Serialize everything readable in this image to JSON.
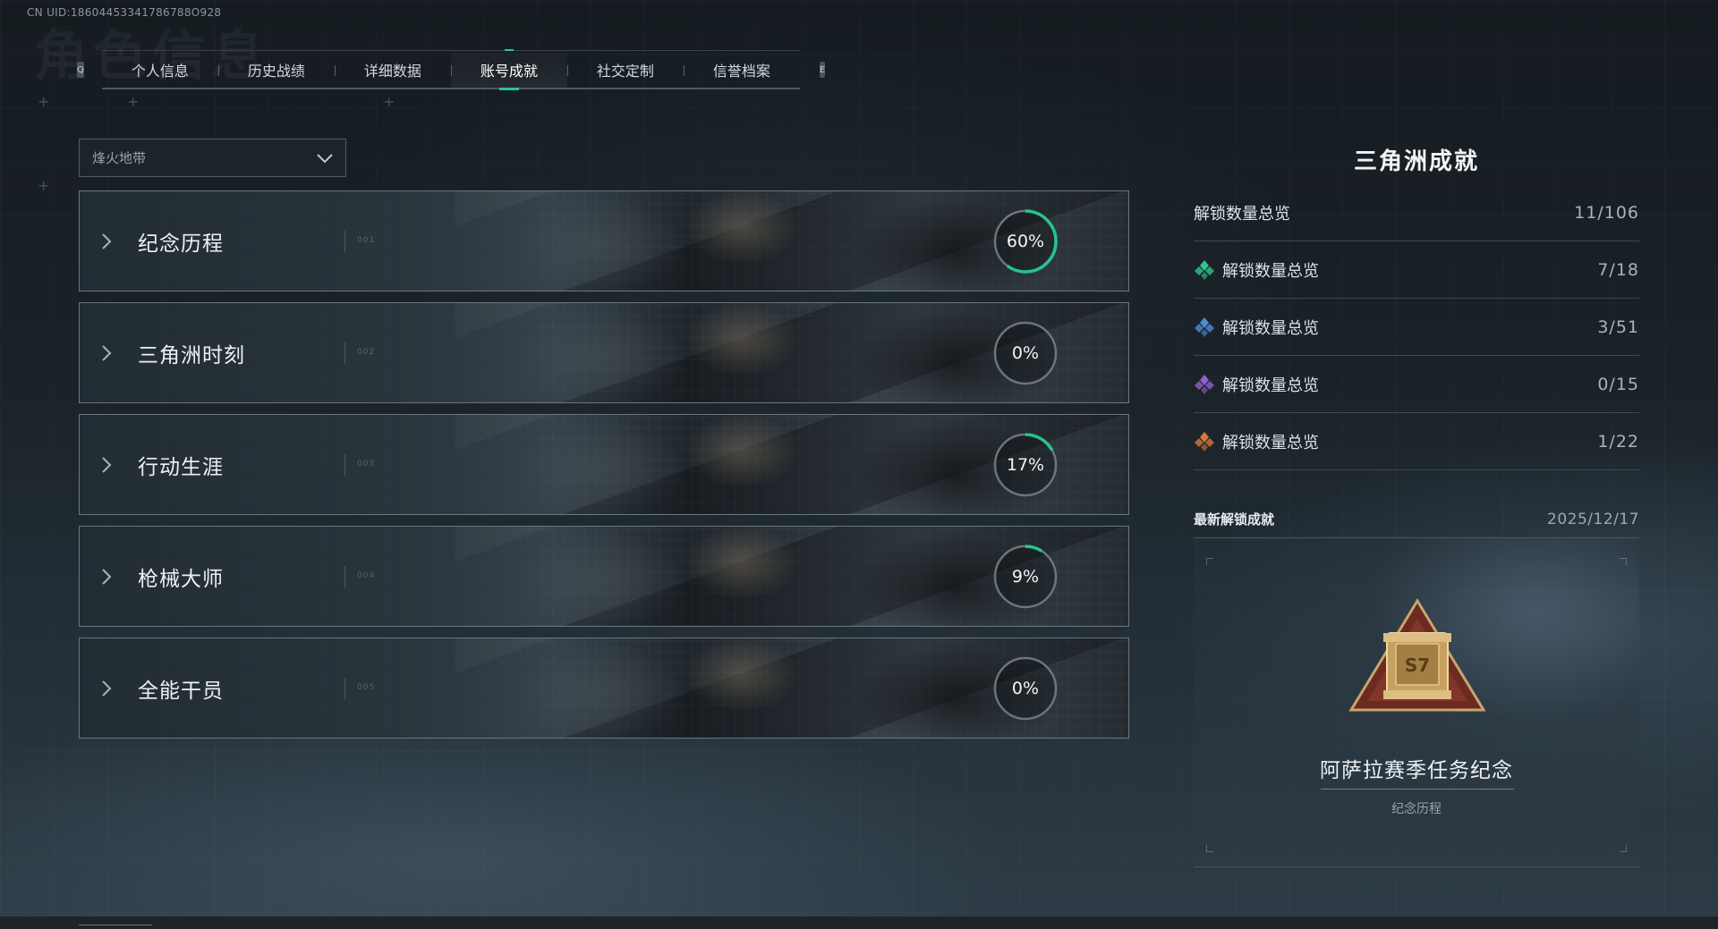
{
  "uid_text": "CN UID:18604453341786788O928",
  "ghost_title": "角色信息",
  "tabs": {
    "prev_key": "Q",
    "next_key": "E",
    "items": [
      {
        "label": "个人信息"
      },
      {
        "label": "历史战绩"
      },
      {
        "label": "详细数据"
      },
      {
        "label": "账号成就",
        "active": true
      },
      {
        "label": "社交定制"
      },
      {
        "label": "信誉档案"
      }
    ]
  },
  "mode_select": {
    "value": "烽火地带",
    "icon": "chevron-down-icon"
  },
  "categories": [
    {
      "name": "纪念历程",
      "index": "001",
      "progress_percent": 60,
      "progress_label": "60%"
    },
    {
      "name": "三角洲时刻",
      "index": "002",
      "progress_percent": 0,
      "progress_label": "0%"
    },
    {
      "name": "行动生涯",
      "index": "003",
      "progress_percent": 17,
      "progress_label": "17%"
    },
    {
      "name": "枪械大师",
      "index": "004",
      "progress_percent": 9,
      "progress_label": "9%"
    },
    {
      "name": "全能干员",
      "index": "005",
      "progress_percent": 0,
      "progress_label": "0%"
    }
  ],
  "panel": {
    "title": "三角洲成就",
    "total": {
      "label": "解锁数量总览",
      "value": "11/106"
    },
    "tiers": [
      {
        "label": "解锁数量总览",
        "value": "7/18",
        "color": "#2fc58f",
        "icon": "green-gem-icon"
      },
      {
        "label": "解锁数量总览",
        "value": "3/51",
        "color": "#4c8fd6",
        "icon": "blue-gem-icon"
      },
      {
        "label": "解锁数量总览",
        "value": "0/15",
        "color": "#9160d0",
        "icon": "purple-gem-icon"
      },
      {
        "label": "解锁数量总览",
        "value": "1/22",
        "color": "#d9763b",
        "icon": "orange-gem-icon"
      }
    ],
    "latest": {
      "heading": "最新解锁成就",
      "date": "2025/12/17",
      "name": "阿萨拉赛季任务纪念",
      "category": "纪念历程",
      "badge_text": "S7"
    }
  },
  "colors": {
    "accent": "#27c48f",
    "ring_track": "#6b757c"
  }
}
